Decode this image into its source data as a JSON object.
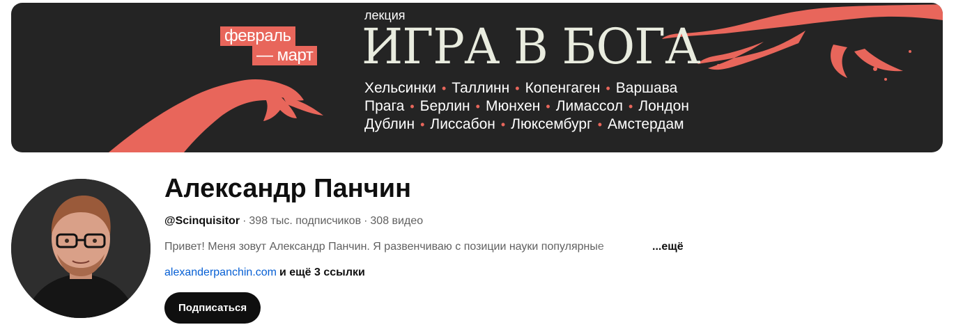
{
  "banner": {
    "date_line1": "февраль",
    "date_line2": "— март",
    "lecture_label": "лекция",
    "lecture_title": "ИГРА В БОГА",
    "cities": [
      [
        "Хельсинки",
        "Таллинн",
        "Копенгаген",
        "Варшава"
      ],
      [
        "Прага",
        "Берлин",
        "Мюнхен",
        "Лимассол",
        "Лондон"
      ],
      [
        "Дублин",
        "Лиссабон",
        "Люксембург",
        "Амстердам"
      ]
    ],
    "colors": {
      "background": "#242424",
      "accent": "#e8665b",
      "title": "#e9ecdf"
    }
  },
  "channel": {
    "name": "Александр Панчин",
    "handle": "@Scinquisitor",
    "subscribers": "398 тыс. подписчиков",
    "videos": "308 видео",
    "description": "Привет! Меня зовут Александр Панчин. Я развенчиваю с позиции науки популярные",
    "description_more": "...ещё",
    "link": "alexanderpanchin.com",
    "more_links": "и ещё 3 ссылки",
    "subscribe_label": "Подписаться"
  }
}
